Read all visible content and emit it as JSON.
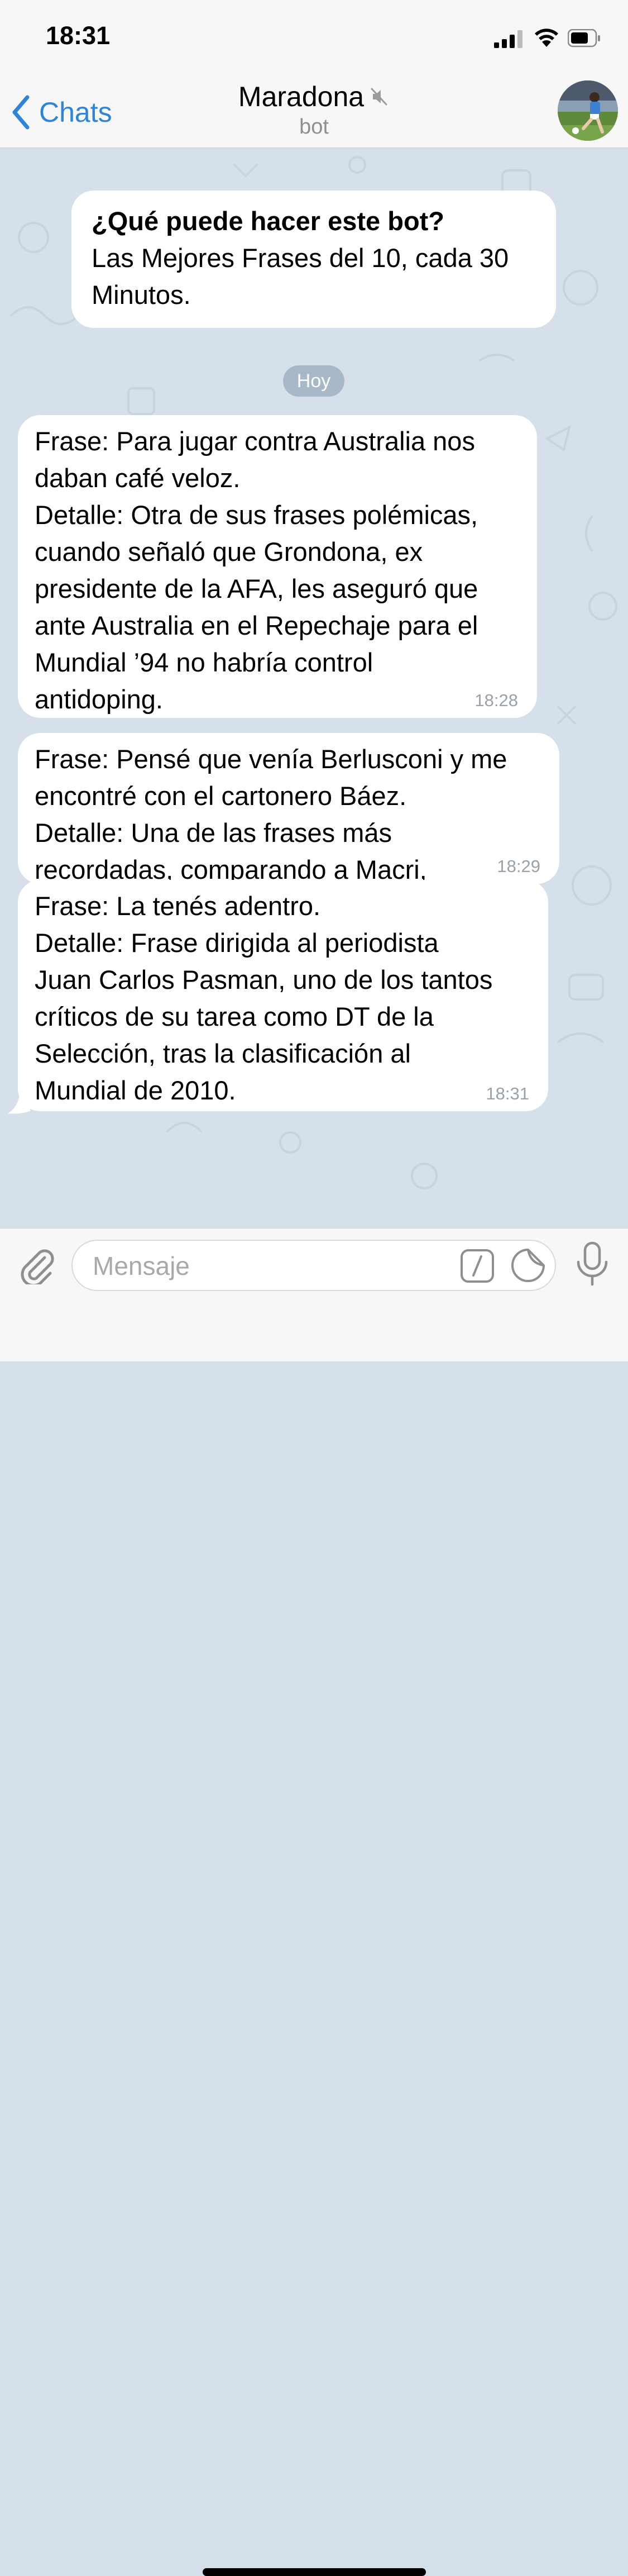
{
  "status_bar": {
    "time": "18:31",
    "icons": [
      "signal-icon",
      "wifi-icon",
      "battery-icon"
    ]
  },
  "nav": {
    "back_label": "Chats",
    "title": "Maradona",
    "subtitle": "bot",
    "muted_icon": "speaker-muted-icon",
    "accent_color": "#2e84d9"
  },
  "chat": {
    "intro": {
      "title": "¿Qué puede hacer este bot?",
      "body": "Las Mejores Frases del 10, cada 30 Minutos."
    },
    "date_label": "Hoy",
    "messages": [
      {
        "text": "Frase: Para jugar contra Australia nos\ndaban café veloz.\nDetalle: Otra de sus frases polémicas,\ncuando señaló que Grondona, ex\npresidente de la AFA, les aseguró que\nante Australia en el Repechaje para el\nMundial ’94 no habría control\nantidoping.",
        "time": "18:28"
      },
      {
        "text": "Frase: Pensé que venía Berlusconi y me\nencontré con el cartonero Báez.\nDetalle: Una de las frases más\nrecordadas, comparando a Macri,\npresidente de Boca, con el cartonero\ndel caso Monzón.",
        "time": "18:29"
      },
      {
        "text": "Frase: La tenés adentro.\nDetalle: Frase dirigida al periodista\nJuan Carlos Pasman, uno de los tantos\ncríticos de su tarea como DT de la\nSelección, tras la clasificación al\nMundial de 2010.",
        "time": "18:31"
      }
    ]
  },
  "input": {
    "placeholder": "Mensaje",
    "icons": [
      "paperclip-icon",
      "command-icon",
      "sticker-icon",
      "microphone-icon"
    ]
  }
}
